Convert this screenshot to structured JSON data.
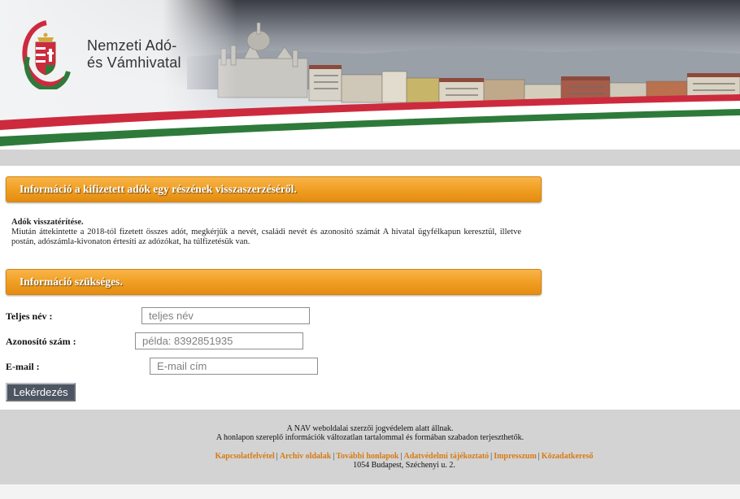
{
  "header": {
    "logo_line1": "Nemzeti Adó-",
    "logo_line2": "és Vámhivatal",
    "colors": {
      "red": "#cd2a3e",
      "green": "#2e7a3a",
      "white": "#ffffff"
    }
  },
  "section1": {
    "title": "Információ a kifizetett adók egy részének visszaszerzéséről.",
    "info_title": "Adók visszatérítése.",
    "info_text": "Miután áttekintette a 2018-tól fizetett összes adót, megkérjük a nevét, családi nevét és azonosító számát A hivatal ügyfélkapun keresztül, illetve postán, adószámla-kivonaton értesíti az adózókat, ha túlfizetésük van."
  },
  "section2": {
    "title": "Információ szükséges."
  },
  "form": {
    "name_label": "Teljes név :",
    "name_placeholder": "teljes név",
    "id_label": "Azonosító szám :",
    "id_placeholder": "példa: 8392851935",
    "email_label": "E-mail :",
    "email_placeholder": "E-mail cím",
    "submit_label": "Lekérdezés"
  },
  "footer": {
    "copyright": "A NAV weboldalai szerzői jogvédelem alatt állnak.",
    "usage": "A honlapon szereplő információk változatlan tartalommal és formában szabadon terjeszthetők.",
    "links": [
      "Kapcsolatfelvétel",
      "Archív oldalak",
      "További honlapok",
      "Adatvédelmi tájékoztató",
      "Impresszum",
      "Közadatkereső"
    ],
    "address": "1054 Budapest, Széchenyi u. 2.",
    "link_color": "#d97a12"
  }
}
